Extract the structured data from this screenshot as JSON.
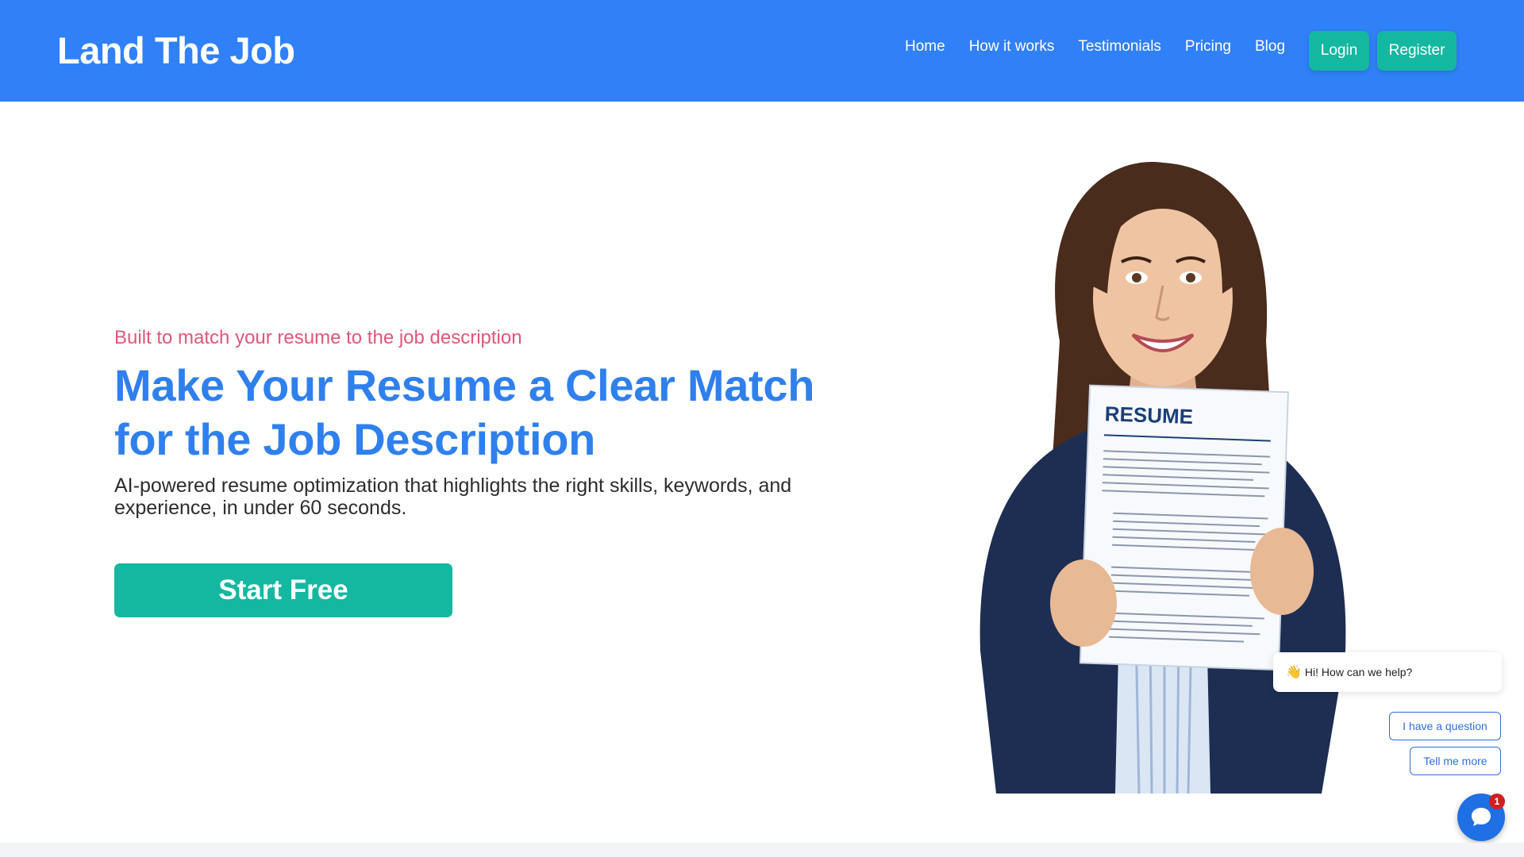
{
  "header": {
    "logo": "Land The Job",
    "nav": [
      "Home",
      "How it works",
      "Testimonials",
      "Pricing",
      "Blog"
    ],
    "login_label": "Login",
    "register_label": "Register"
  },
  "hero": {
    "tagline": "Built to match your resume to the job description",
    "headline": "Make Your Resume a Clear Match for the Job Description",
    "subtext": "AI-powered resume optimization that highlights the right skills, keywords, and experience, in under 60 seconds.",
    "cta_label": "Start Free",
    "resume_title": "RESUME"
  },
  "chat": {
    "greeting": "Hi! How can we help?",
    "greeting_icon": "waving-hand-icon",
    "options": [
      "I have a question",
      "Tell me more"
    ],
    "badge_count": "1"
  },
  "colors": {
    "header_bg": "#3080f8",
    "accent_teal": "#14b8a0",
    "headline_blue": "#2f80ed",
    "tagline_pink": "#e0567a"
  }
}
